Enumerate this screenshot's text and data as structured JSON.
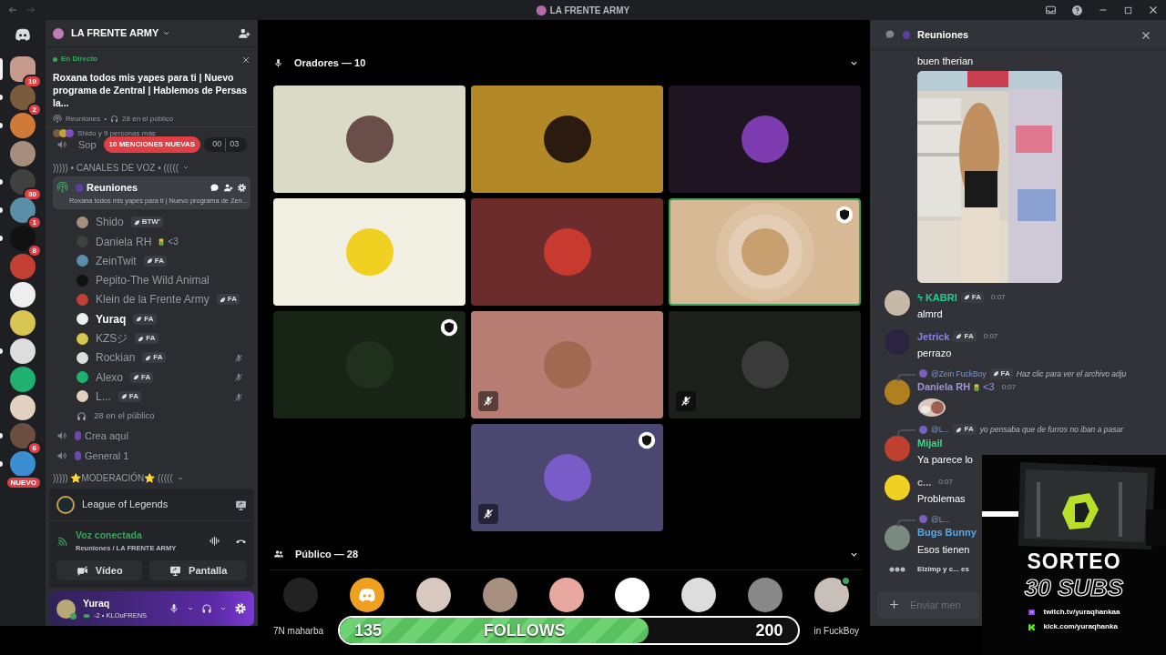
{
  "window": {
    "title": "LA FRENTE ARMY"
  },
  "servers": [
    {
      "badge": "10",
      "selected": true
    },
    {
      "badge": "2",
      "selected": false,
      "unread": true
    },
    {
      "selected": false,
      "unread": true
    },
    {
      "selected": false,
      "unread": false
    },
    {
      "badge": "30",
      "selected": false,
      "unread": true
    },
    {
      "badge": "1",
      "selected": false,
      "unread": true
    },
    {
      "badge": "8",
      "selected": false,
      "unread": true
    },
    {
      "selected": false,
      "unread": false
    },
    {
      "selected": false,
      "unread": false
    },
    {
      "selected": false,
      "unread": false
    },
    {
      "selected": false,
      "unread": true
    },
    {
      "selected": false,
      "unread": false
    },
    {
      "selected": false,
      "unread": false
    },
    {
      "badge": "6",
      "selected": false,
      "unread": true
    },
    {
      "badge": "NUEVO",
      "selected": false,
      "unread": true
    }
  ],
  "sidebar": {
    "server_name": "LA FRENTE ARMY",
    "live": {
      "label": "En Directo",
      "title": "Roxana todos mis yapes para ti | Nuevo programa de Zentral | Hablemos de Persas la...",
      "channel": "Reuniones",
      "separator": "•",
      "audience": "28 en el público",
      "participants": "Shido y 9 personas más"
    },
    "channels": [
      {
        "kind": "voice",
        "name": "Sop",
        "pill": "10 MENCIONES NUEVAS",
        "counter": [
          "00",
          "03"
        ]
      },
      {
        "kind": "category",
        "name": "))))) • CANALES DE VOZ • (((((",
        "expanded": true
      },
      {
        "kind": "stage",
        "name": "Reuniones",
        "selected": true,
        "topic": "Roxana todos mis yapes para ti | Nuevo programa de Zen...",
        "audience": "28 en el público",
        "members": [
          {
            "name": "Shido",
            "guild_tag": "BTW'",
            "muted": false,
            "speaking": false
          },
          {
            "name": "Daniela RH",
            "status": "<3",
            "muted": false,
            "speaking": false
          },
          {
            "name": "ZeinTwit",
            "guild_tag": "FA",
            "muted": false,
            "speaking": false
          },
          {
            "name": "Pepito-The Wild Animal",
            "muted": false,
            "speaking": false
          },
          {
            "name": "Klein de la Frente Army",
            "guild_tag": "FA",
            "muted": false,
            "speaking": false
          },
          {
            "name": "Yuraq",
            "guild_tag": "FA",
            "muted": false,
            "speaking": true
          },
          {
            "name": "KZSジ",
            "guild_tag": "FA",
            "muted": false,
            "speaking": false
          },
          {
            "name": "Rockian",
            "guild_tag": "FA",
            "muted": true,
            "speaking": false
          },
          {
            "name": "Alexo",
            "guild_tag": "FA",
            "muted": true,
            "speaking": false
          },
          {
            "name": "L...",
            "guild_tag": "FA",
            "muted": true,
            "speaking": false
          }
        ]
      },
      {
        "kind": "voice",
        "name": "Crea aquí"
      },
      {
        "kind": "voice",
        "name": "General 1"
      },
      {
        "kind": "category",
        "name": "))))) ⭐MODERACIÓN⭐ (((((",
        "expanded": true
      }
    ],
    "activity": {
      "game": "League of Legends",
      "voice_status": "Voz conectada",
      "voice_channel": "Reuniones / LA FRENTE ARMY",
      "buttons": [
        "Vídeo",
        "Pantalla"
      ]
    },
    "user": {
      "name": "Yuraq",
      "status": "-2 • KLOuFRENS"
    }
  },
  "stage": {
    "speakers_label": "Oradores — 10",
    "speakers": [
      {
        "color": "#d9dbc6",
        "muted": false,
        "badge": false,
        "speaking": false
      },
      {
        "color": "#b38826",
        "muted": false,
        "badge": false,
        "speaking": false
      },
      {
        "color": "#1f1422",
        "muted": false,
        "badge": false,
        "speaking": false
      },
      {
        "color": "#f2f0e2",
        "muted": false,
        "badge": false,
        "speaking": false
      },
      {
        "color": "#6d2c2c",
        "muted": false,
        "badge": false,
        "speaking": false
      },
      {
        "color": "#d8b996",
        "muted": false,
        "badge": true,
        "speaking": true
      },
      {
        "color": "#182516",
        "muted": false,
        "badge": true,
        "speaking": false
      },
      {
        "color": "#b77d73",
        "muted": true,
        "badge": false,
        "speaking": false
      },
      {
        "color": "#1c1f1c",
        "muted": true,
        "badge": false,
        "speaking": false
      },
      {
        "color": "#4a4770",
        "muted": true,
        "badge": true,
        "speaking": false
      }
    ],
    "audience_label": "Público — 28",
    "audience": [
      {
        "kind": "person",
        "name": "7N maharba"
      },
      {
        "kind": "discord"
      },
      {
        "kind": "person"
      },
      {
        "kind": "person"
      },
      {
        "kind": "person"
      },
      {
        "kind": "person"
      },
      {
        "kind": "person"
      },
      {
        "kind": "person"
      },
      {
        "kind": "person",
        "online": true,
        "name": "in FuckBoy"
      }
    ],
    "follows": {
      "current": "135",
      "label": "FOLLOWS",
      "goal": "200",
      "level": 0.675
    }
  },
  "chat": {
    "title": "Reuniones",
    "messages": [
      {
        "text": "buen therian"
      },
      {
        "author": "ϟ KABRI",
        "color": "#1fcf8a",
        "guild_tag": "FA",
        "time": "0:07",
        "text": "almrd"
      },
      {
        "author": "Jetrick",
        "color": "#8f7fe0",
        "guild_tag": "FA",
        "time": "0:07",
        "text": "perrazo"
      },
      {
        "reply": {
          "author": "@Zein FuckBoy",
          "tag": "FA",
          "text": "Haz clic para ver el archivo adju"
        },
        "author": "Daniela RH",
        "color": "#a193d4",
        "status": "<3",
        "time": "0:07",
        "attachment": {
          "kind": "sticker"
        }
      },
      {
        "reply": {
          "author": "@L...",
          "tag": "FA",
          "text": "yo pensaba que de furros no iban a pasar"
        },
        "author": "Mijail",
        "color": "#3fd38b",
        "text": "Ya parece lo"
      },
      {
        "author": "c...",
        "color": "#b5bac1",
        "time": "0:07",
        "text": "Problemas"
      },
      {
        "reply": {
          "author": "@L..."
        },
        "author": "Bugs Bunny",
        "color": "#5aa8e0",
        "text": "Esos tienen"
      }
    ],
    "typing": "Elzimp y c... es",
    "placeholder": "Enviar men"
  },
  "poster": {
    "title": "SORTEO",
    "subtitle": "30 SUBS",
    "links": [
      {
        "kind": "twitch",
        "text": "twitch.tv/yuraqhankaa"
      },
      {
        "kind": "kick",
        "text": "kick.com/yuraqhanka"
      }
    ]
  }
}
